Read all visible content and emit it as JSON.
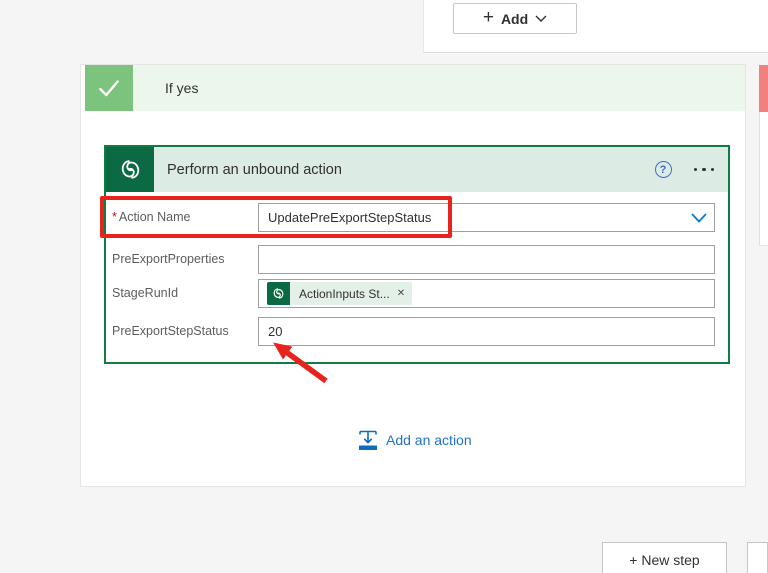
{
  "colors": {
    "card_green": "#0b6a43",
    "card_border_green": "#117c42",
    "header_light_green": "#dcebe3",
    "check_square_green": "#7cc47e",
    "ifyes_bar_green": "#edf6ed",
    "ifno_bar_red": "#f2817d",
    "annotation_red": "#e8231d",
    "link_blue": "#2272c9"
  },
  "top_panel": {
    "add_button": {
      "plus": "+",
      "label": "Add"
    }
  },
  "if_yes": {
    "label": "If yes"
  },
  "action_card": {
    "title": "Perform an unbound action",
    "required_marker": "*",
    "help_label": "?",
    "fields": [
      {
        "label": "Action Name",
        "value": "UpdatePreExportStepStatus"
      },
      {
        "label": "PreExportProperties",
        "value": ""
      },
      {
        "label": "StageRunId",
        "token": {
          "text": "ActionInputs St...",
          "close": "✕"
        }
      },
      {
        "label": "PreExportStepStatus",
        "value": "20"
      }
    ],
    "add_action_label": "Add an action"
  },
  "footer": {
    "new_step_label": "+ New step"
  }
}
